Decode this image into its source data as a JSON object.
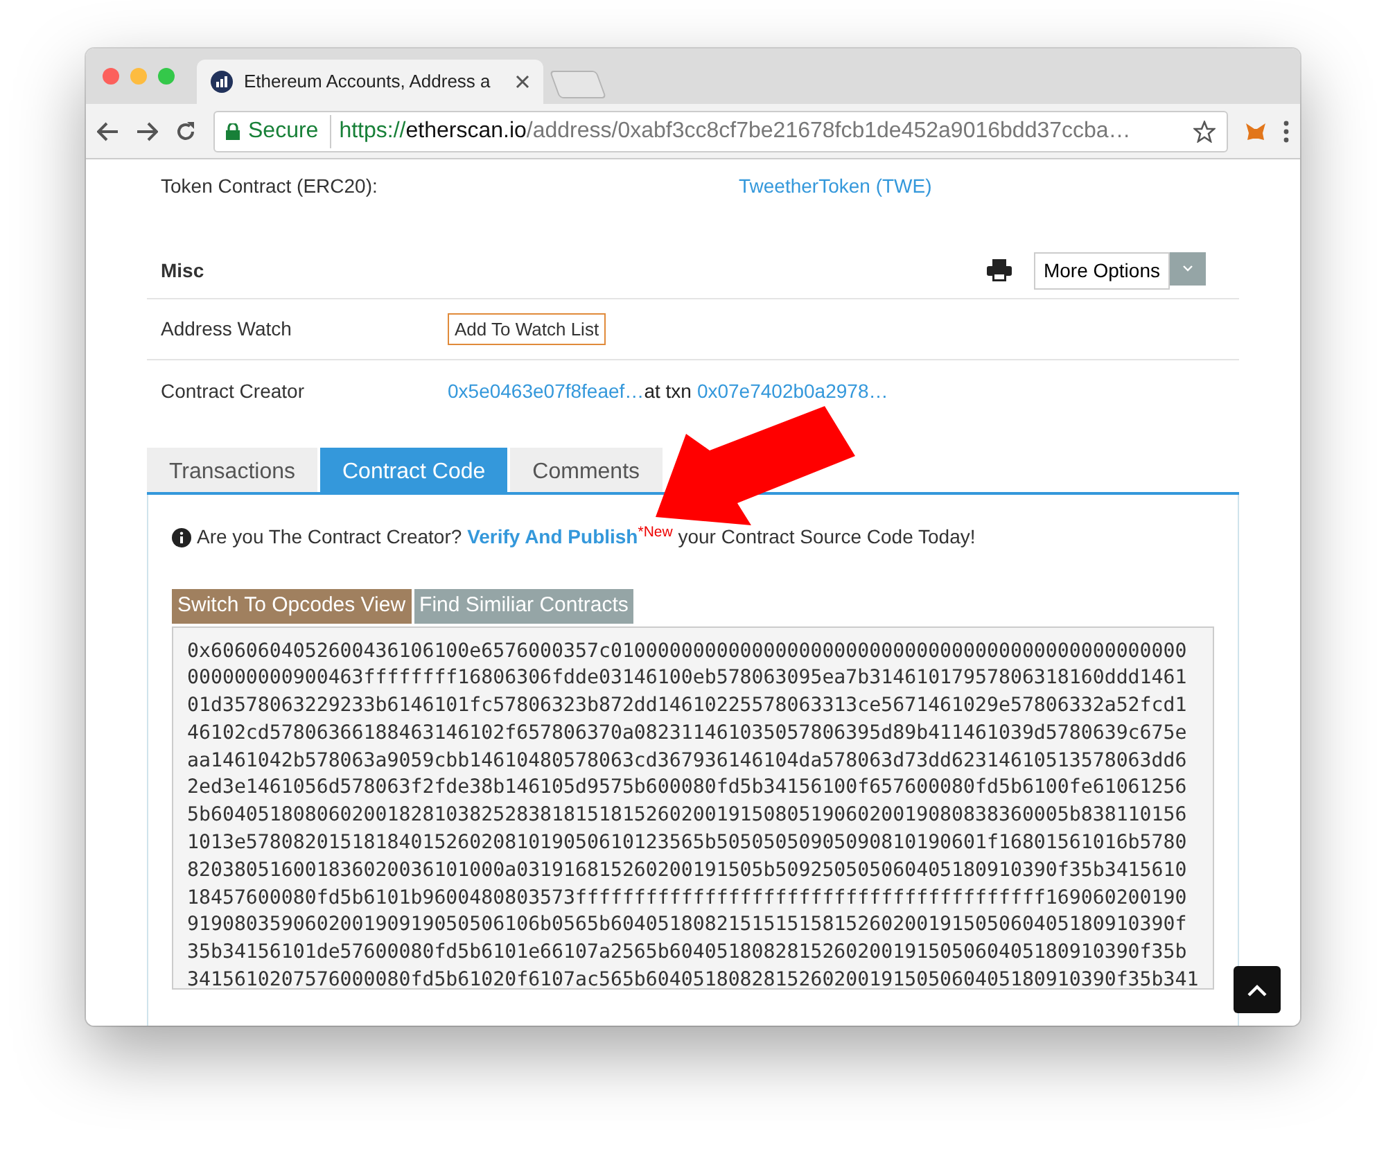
{
  "browser": {
    "tab_title": "Ethereum Accounts, Address a",
    "secure_label": "Secure",
    "url": {
      "scheme": "https://",
      "host": "etherscan.io",
      "path": "/address/0xabf3cc8cf7be21678fcb1de452a9016bdd37ccba…"
    }
  },
  "token_contract": {
    "label": "Token Contract (ERC20):",
    "value": "TweetherToken (TWE)"
  },
  "misc": {
    "title": "Misc",
    "more_options": "More Options"
  },
  "address_watch": {
    "label": "Address Watch",
    "button": "Add To Watch List"
  },
  "contract_creator": {
    "label": "Contract Creator",
    "creator": "0x5e0463e07f8feaef…",
    "at_text": "at txn",
    "txn": "0x07e7402b0a2978…"
  },
  "tabs": [
    {
      "label": "Transactions",
      "selected": false
    },
    {
      "label": "Contract Code",
      "selected": true
    },
    {
      "label": "Comments",
      "selected": false
    }
  ],
  "notice": {
    "before": "Are you The Contract Creator?",
    "link": "Verify And Publish",
    "badge": "*New",
    "after": "your Contract Source Code Today!"
  },
  "code_buttons": [
    {
      "label": "Switch To Opcodes View",
      "kind": "primary"
    },
    {
      "label": "Find Similiar Contracts",
      "kind": "secondary"
    }
  ],
  "bytecode": [
    "0x6060604052600436106100e6576000357c0100000000000000000000000000000000000000000000000",
    "000000000900463ffffffff16806306fdde03146100eb578063095ea7b31461017957806318160ddd1461",
    "01d3578063229233b6146101fc57806323b872dd14610225578063313ce5671461029e57806332a52fcd1",
    "46102cd57806366188463146102f657806370a082311461035057806395d89b411461039d5780639c675e",
    "aa1461042b578063a9059cbb14610480578063cd367936146104da578063d73dd62314610513578063dd6",
    "2ed3e1461056d578063f2fde38b146105d9575b600080fd5b34156100f657600080fd5b6100fe61061256",
    "5b6040518080602001828103825283818151815260200191508051906020019080838360005b838110156",
    "1013e578082015181840152602081019050610123565b50505050905090810190601f16801561016b5780",
    "820380516001836020036101000a031916815260200191505b509250505060405180910390f35b3415610",
    "18457600080fd5b6101b9600480803573ffffffffffffffffffffffffffffffffffffffff169060200190",
    "919080359060200190919050506106b0565b604051808215151515815260200191505060405180910390f",
    "35b34156101de57600080fd5b6101e66107a2565b6040518082815260200191505060405180910390f35b",
    "3415610207576000080fd5b61020f6107ac565b6040518082815260200191505060405180910390f35b341"
  ]
}
